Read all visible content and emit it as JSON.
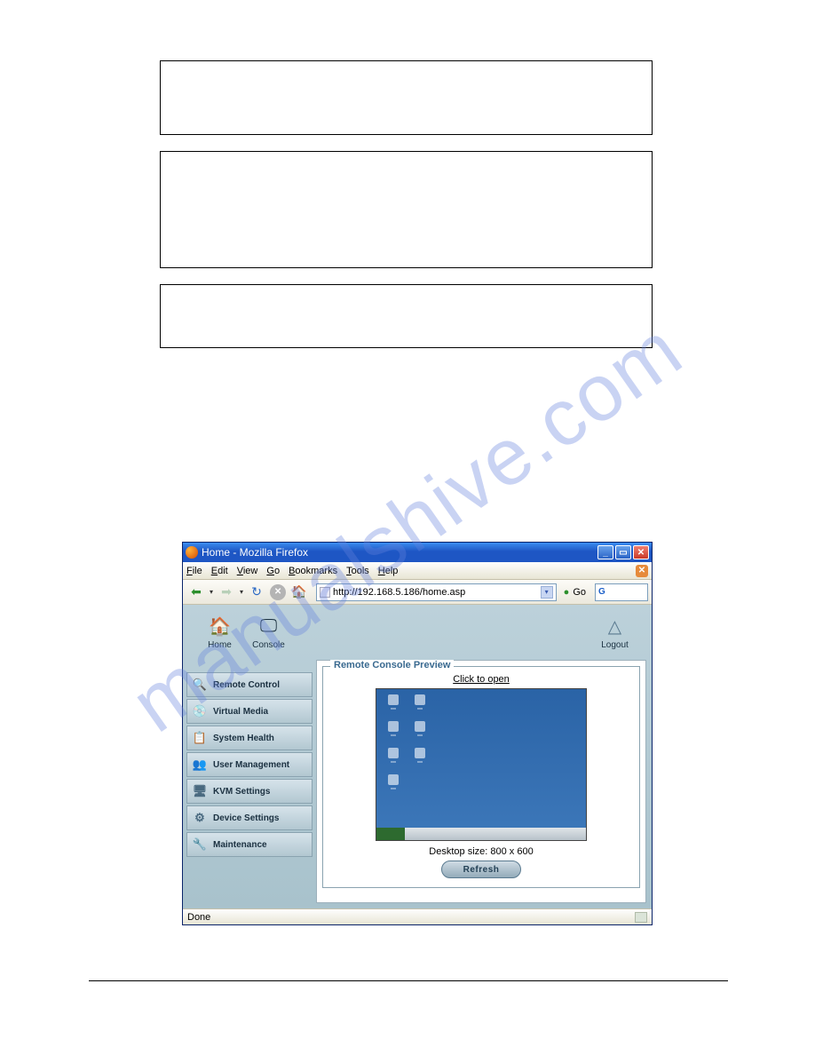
{
  "window": {
    "title": "Home - Mozilla Firefox",
    "menu": [
      "File",
      "Edit",
      "View",
      "Go",
      "Bookmarks",
      "Tools",
      "Help"
    ],
    "url": "http://192.168.5.186/home.asp",
    "go": "Go",
    "status": "Done"
  },
  "topnav": {
    "home": "Home",
    "console": "Console",
    "logout": "Logout"
  },
  "sidebar": {
    "items": [
      {
        "label": "Remote Control",
        "icon": "🔍"
      },
      {
        "label": "Virtual Media",
        "icon": "💿"
      },
      {
        "label": "System Health",
        "icon": "📋"
      },
      {
        "label": "User Management",
        "icon": "👥"
      },
      {
        "label": "KVM Settings",
        "icon": "🖥"
      },
      {
        "label": "Device Settings",
        "icon": "⚙"
      },
      {
        "label": "Maintenance",
        "icon": "🔧"
      }
    ]
  },
  "preview": {
    "legend": "Remote Console Preview",
    "click": "Click to open",
    "desktop_size": "Desktop size: 800 x 600",
    "refresh": "Refresh"
  }
}
